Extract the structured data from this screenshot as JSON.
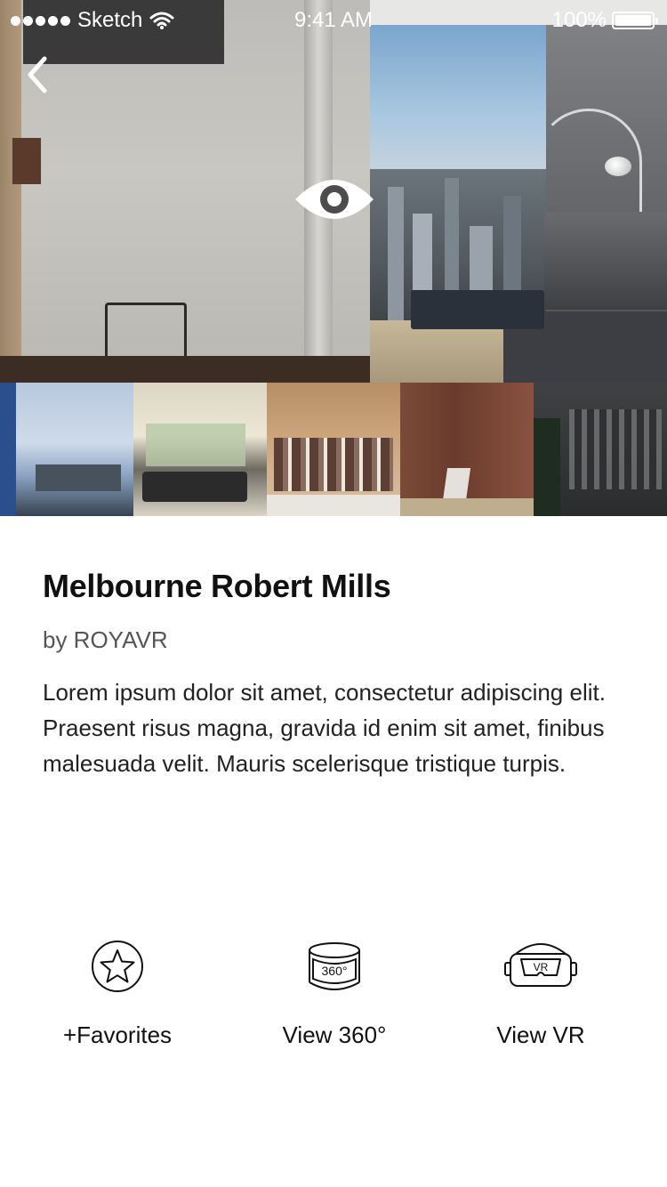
{
  "status_bar": {
    "carrier": "Sketch",
    "time": "9:41 AM",
    "battery": "100%"
  },
  "nav": {
    "back_icon": "chevron-left-icon"
  },
  "hero": {
    "overlay_icon": "eye-icon"
  },
  "gallery": {
    "thumbnails": [
      "kitchen",
      "bedroom",
      "walk-in-closet",
      "wood-wall",
      "wardrobe"
    ]
  },
  "listing": {
    "title": "Melbourne Robert Mills",
    "author": "by ROYAVR",
    "description": "Lorem ipsum dolor sit amet, consectetur adipiscing elit. Praesent risus magna, gravida id enim sit amet, finibus malesuada velit. Mauris scelerisque tristique turpis."
  },
  "actions": {
    "favorites_label": "+Favorites",
    "view360_label": "View 360°",
    "view360_icon_text": "360°",
    "vr_label": "View VR",
    "vr_icon_text": "VR"
  },
  "colors": {
    "text_primary": "#111111",
    "text_secondary": "#555555",
    "background": "#ffffff"
  }
}
